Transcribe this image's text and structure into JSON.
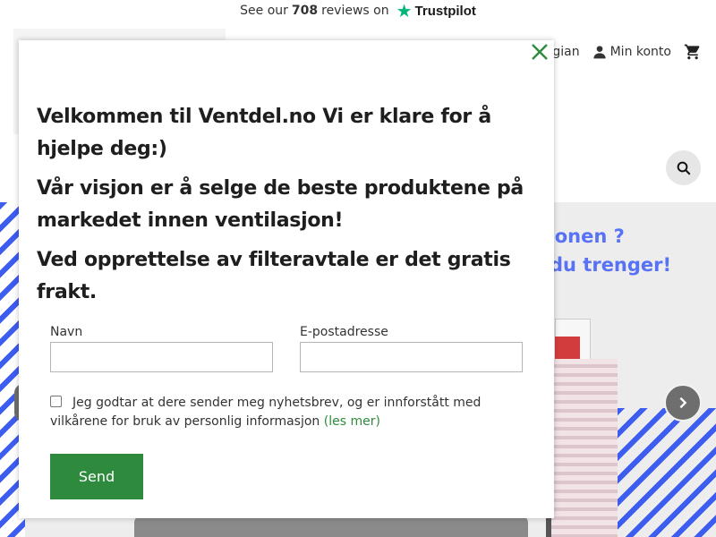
{
  "topbar": {
    "prefix": "See our",
    "count": "708",
    "suffix": "reviews on",
    "brand": "Trustpilot"
  },
  "header": {
    "language": "Norwegian",
    "account": "Min konto"
  },
  "hero": {
    "line1": "sjonen ?",
    "line2": "du trenger!"
  },
  "modal": {
    "heading1": "Velkommen til Ventdel.no Vi er klare for å hjelpe deg:)",
    "heading2": "Vår visjon er å selge de beste produktene på markedet innen ventilasjon!",
    "heading3": "Ved opprettelse av filteravtale er det gratis frakt.",
    "name_label": "Navn",
    "email_label": "E-postadresse",
    "name_value": "",
    "email_value": "",
    "consent_text": "Jeg godtar at dere sender meg nyhetsbrev, og er innforstått med vilkårene for bruk av personlig informasjon",
    "consent_link": "(les mer)",
    "send_label": "Send"
  },
  "colors": {
    "accent": "#2e8b3d",
    "trustpilot": "#00b67a",
    "banner_blue": "#3d5cf0"
  }
}
